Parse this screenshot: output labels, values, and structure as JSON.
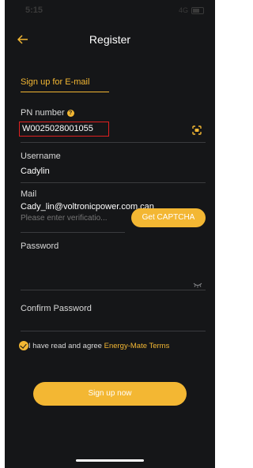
{
  "status_bar": {
    "time": "5:15",
    "signal": "4G"
  },
  "header": {
    "title": "Register"
  },
  "section": {
    "title": "Sign up for E-mail"
  },
  "pn": {
    "label": "PN number",
    "value": "W0025028001055"
  },
  "username": {
    "label": "Username",
    "value": "Cadylin"
  },
  "mail": {
    "label": "Mail",
    "value": "Cady_lin@voltronicpower.com.can"
  },
  "verification": {
    "placeholder": "Please enter verificatio...",
    "captcha_label": "Get CAPTCHA"
  },
  "password": {
    "label": "Password"
  },
  "confirm_password": {
    "label": "Confirm Password"
  },
  "agreement": {
    "text": "I have read and agree",
    "link": "Energy-Mate Terms"
  },
  "signup": {
    "label": "Sign up now"
  },
  "colors": {
    "accent": "#f3b733",
    "background": "#151618",
    "highlight_box": "#e02020"
  }
}
